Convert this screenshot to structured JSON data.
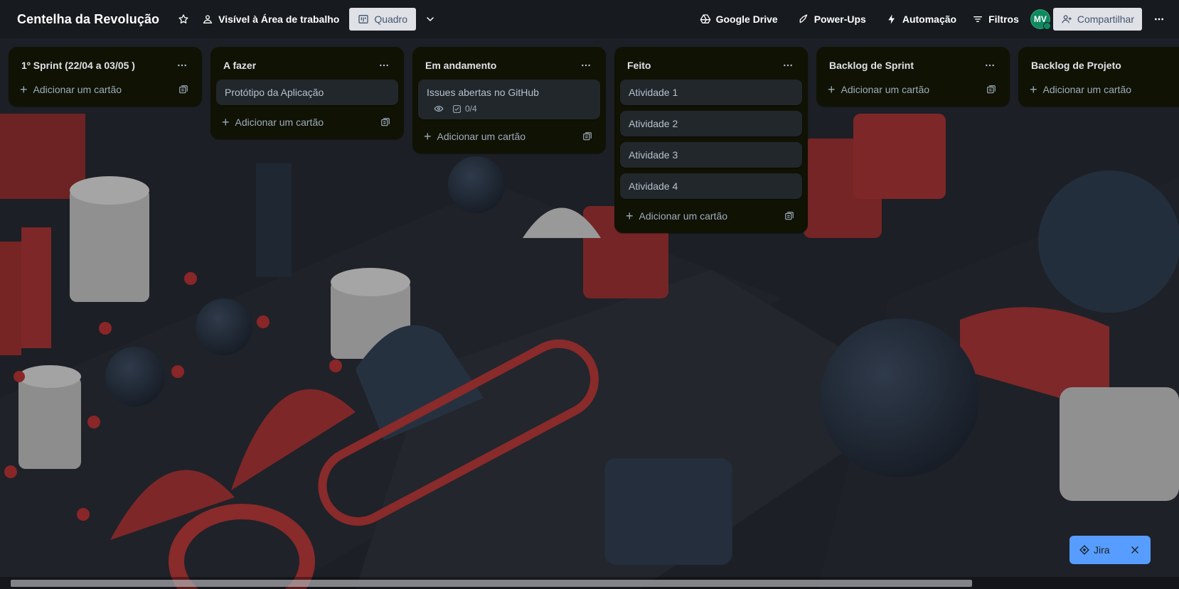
{
  "header": {
    "title": "Centelha da Revolução",
    "visibility_label": "Visível à Área de trabalho",
    "view_label": "Quadro",
    "google_drive_label": "Google Drive",
    "powerups_label": "Power-Ups",
    "automation_label": "Automação",
    "filters_label": "Filtros",
    "avatar_initials": "MV",
    "share_label": "Compartilhar"
  },
  "add_card_label": "Adicionar um cartão",
  "lists": [
    {
      "title": "1º Sprint (22/04 a 03/05 )",
      "cards": []
    },
    {
      "title": "A fazer",
      "cards": [
        {
          "title": "Protótipo da Aplicação"
        }
      ]
    },
    {
      "title": "Em andamento",
      "cards": [
        {
          "title": "Issues abertas no GitHub",
          "checklist": "0/4"
        }
      ]
    },
    {
      "title": "Feito",
      "cards": [
        {
          "title": "Atividade 1"
        },
        {
          "title": "Atividade 2"
        },
        {
          "title": "Atividade 3"
        },
        {
          "title": "Atividade 4"
        }
      ]
    },
    {
      "title": "Backlog de Sprint",
      "cards": []
    },
    {
      "title": "Backlog de Projeto",
      "cards": []
    }
  ],
  "jira": {
    "label": "Jira"
  },
  "colors": {
    "list_bg": "#101204",
    "card_bg": "#22272b",
    "accent_blue": "#579dff",
    "avatar_green": "#0f8a5f"
  }
}
